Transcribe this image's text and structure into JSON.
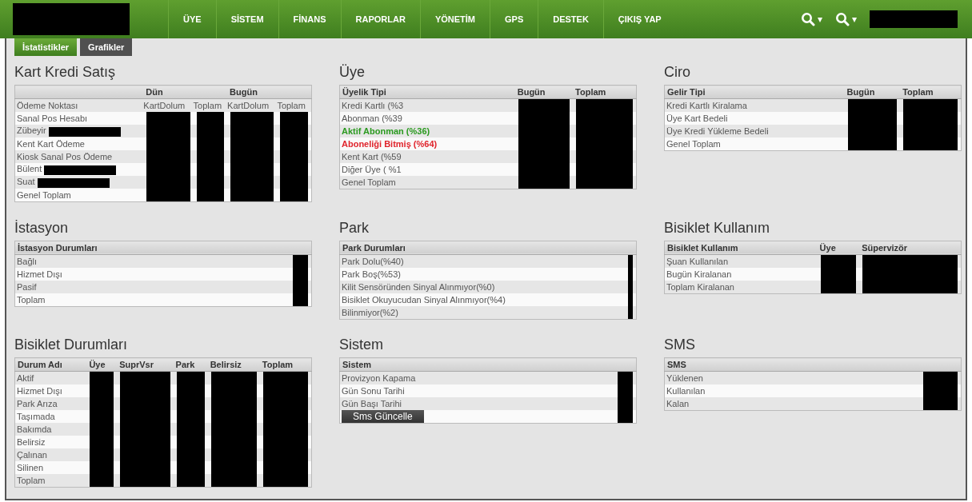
{
  "header": {
    "logo_redacted": true,
    "nav": [
      {
        "label": "ÜYE"
      },
      {
        "label": "SİSTEM"
      },
      {
        "label": "FİNANS"
      },
      {
        "label": "RAPORLAR"
      },
      {
        "label": "YÖNETİM"
      },
      {
        "label": "GPS"
      },
      {
        "label": "DESTEK"
      },
      {
        "label": "ÇIKIŞ YAP"
      }
    ],
    "search_menus": [
      {
        "caret": "▾"
      },
      {
        "caret": "▾"
      }
    ],
    "user_redacted": true
  },
  "tabs": [
    {
      "label": "İstatistikler",
      "selected": true
    },
    {
      "label": "Grafikler",
      "selected": false
    }
  ],
  "panels": [
    {
      "title": "Kart Kredi Satış",
      "columns": [
        {},
        {
          "label": "Dün",
          "redacted": true
        },
        {
          "redacted": true
        },
        {
          "label": "Bugün",
          "redacted": true
        },
        {
          "redacted": true
        }
      ],
      "rows": [
        {
          "kind": "subheader",
          "label": "Ödeme Noktası",
          "cells": [
            "KartDolum",
            "Toplam",
            "KartDolum",
            "Toplam"
          ]
        },
        {
          "kind": "normal",
          "label": "Sanal Pos Hesabı"
        },
        {
          "kind": "normal",
          "label": "Zübeyir",
          "name_redacted": true
        },
        {
          "kind": "normal",
          "label": "Kent Kart Ödeme"
        },
        {
          "kind": "normal",
          "label": "Kiosk Sanal Pos Ödeme"
        },
        {
          "kind": "normal",
          "label": "Bülent",
          "name_redacted": true
        },
        {
          "kind": "normal",
          "label": "Suat",
          "name_redacted": true
        },
        {
          "kind": "normal",
          "label": "Genel Toplam"
        }
      ]
    },
    {
      "title": "Üye",
      "columns": [
        {
          "label": "Üyelik Tipi"
        },
        {
          "label": "Bugün",
          "redacted": true
        },
        {
          "label": "Toplam",
          "redacted": true
        }
      ],
      "rows": [
        {
          "kind": "normal",
          "label": "Kredi Kartlı (%3"
        },
        {
          "kind": "normal",
          "label": "Abonman (%39"
        },
        {
          "kind": "positive",
          "label": "Aktif Abonman (%36)"
        },
        {
          "kind": "negative",
          "label": "Aboneliği Bitmiş (%64)"
        },
        {
          "kind": "normal",
          "label": "Kent Kart (%59"
        },
        {
          "kind": "normal",
          "label": "Diğer Üye ( %1"
        },
        {
          "kind": "normal",
          "label": "Genel Toplam"
        }
      ]
    },
    {
      "title": "Ciro",
      "columns": [
        {
          "label": "Gelir Tipi"
        },
        {
          "label": "Bugün",
          "redacted": true
        },
        {
          "label": "Toplam",
          "redacted": true
        }
      ],
      "rows": [
        {
          "kind": "normal",
          "label": "Kredi Kartlı Kiralama"
        },
        {
          "kind": "normal",
          "label": "Üye Kart Bedeli"
        },
        {
          "kind": "normal",
          "label": "Üye Kredi Yükleme Bedeli"
        },
        {
          "kind": "normal",
          "label": "Genel Toplam"
        }
      ]
    },
    {
      "title": "İstasyon",
      "columns": [
        {
          "label": "İstasyon Durumları"
        },
        {
          "redacted": true
        }
      ],
      "rows": [
        {
          "kind": "normal",
          "label": "Bağlı"
        },
        {
          "kind": "normal",
          "label": "Hizmet Dışı"
        },
        {
          "kind": "normal",
          "label": "Pasif"
        },
        {
          "kind": "normal",
          "label": "Toplam"
        }
      ]
    },
    {
      "title": "Park",
      "columns": [
        {
          "label": "Park Durumları"
        },
        {
          "redacted": true
        }
      ],
      "rows": [
        {
          "kind": "normal",
          "label": "Park Dolu(%40)"
        },
        {
          "kind": "normal",
          "label": "Park Boş(%53)"
        },
        {
          "kind": "normal",
          "label": "Kilit Sensöründen Sinyal Alınmıyor(%0)"
        },
        {
          "kind": "normal",
          "label": "Bisiklet Okuyucudan Sinyal Alınmıyor(%4)"
        },
        {
          "kind": "normal",
          "label": "Bilinmiyor(%2)"
        }
      ]
    },
    {
      "title": "Bisiklet Kullanım",
      "columns": [
        {
          "label": "Bisiklet Kullanım"
        },
        {
          "label": "Üye",
          "redacted": true
        },
        {
          "label": "Süpervizör",
          "redacted": true
        }
      ],
      "rows": [
        {
          "kind": "normal",
          "label": "Şuan Kullanılan"
        },
        {
          "kind": "normal",
          "label": "Bugün Kiralanan"
        },
        {
          "kind": "normal",
          "label": "Toplam Kiralanan"
        }
      ]
    },
    {
      "title": "Bisiklet Durumları",
      "columns": [
        {
          "label": "Durum Adı"
        },
        {
          "label": "Üye",
          "redacted": true
        },
        {
          "label": "SuprVsr",
          "redacted": true
        },
        {
          "label": "Park",
          "redacted": true
        },
        {
          "label": "Belirsiz",
          "redacted": true
        },
        {
          "label": "Toplam",
          "redacted": true
        }
      ],
      "rows": [
        {
          "kind": "normal",
          "label": "Aktif"
        },
        {
          "kind": "normal",
          "label": "Hizmet Dışı"
        },
        {
          "kind": "normal",
          "label": "Park Arıza"
        },
        {
          "kind": "normal",
          "label": "Taşımada"
        },
        {
          "kind": "normal",
          "label": "Bakımda"
        },
        {
          "kind": "normal",
          "label": "Belirsiz"
        },
        {
          "kind": "normal",
          "label": "Çalınan"
        },
        {
          "kind": "normal",
          "label": "Silinen"
        },
        {
          "kind": "normal",
          "label": "Toplam"
        }
      ]
    },
    {
      "title": "Sistem",
      "columns": [
        {
          "label": "Sistem"
        },
        {
          "redacted": true
        }
      ],
      "rows": [
        {
          "kind": "normal",
          "label": "Provizyon Kapama"
        },
        {
          "kind": "normal",
          "label": "Gün Sonu Tarihi"
        },
        {
          "kind": "normal",
          "label": "Gün Başı Tarihi"
        },
        {
          "kind": "button",
          "label": "Sms Güncelle"
        }
      ]
    },
    {
      "title": "SMS",
      "columns": [
        {
          "label": "SMS"
        },
        {
          "redacted": true
        }
      ],
      "rows": [
        {
          "kind": "normal",
          "label": "Yüklenen"
        },
        {
          "kind": "normal",
          "label": "Kullanılan"
        },
        {
          "kind": "normal",
          "label": "Kalan"
        }
      ]
    }
  ]
}
